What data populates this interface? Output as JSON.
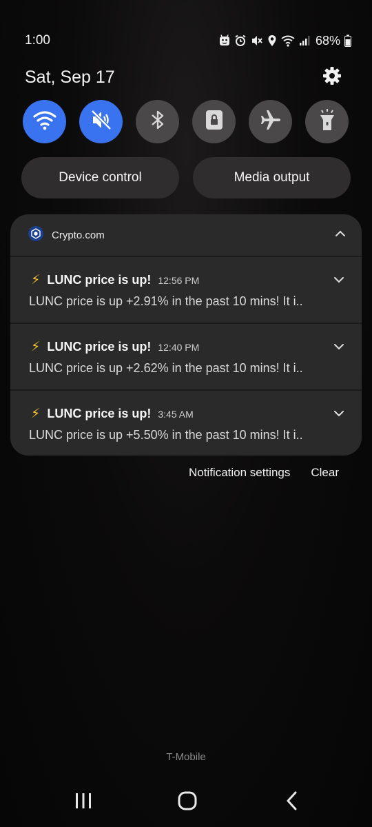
{
  "status_bar": {
    "time": "1:00",
    "battery_percent": "68%",
    "icons": [
      "android-icon",
      "alarm-icon",
      "mute-icon",
      "location-icon",
      "wifi-icon",
      "signal-icon",
      "battery-icon"
    ]
  },
  "quick_panel": {
    "date": "Sat, Sep 17",
    "toggles": [
      {
        "name": "wifi",
        "icon": "wifi-icon",
        "state": "on"
      },
      {
        "name": "sound",
        "icon": "mute-icon",
        "state": "on"
      },
      {
        "name": "bluetooth",
        "icon": "bluetooth-icon",
        "state": "off"
      },
      {
        "name": "portrait-lock",
        "icon": "lock-icon",
        "state": "off"
      },
      {
        "name": "airplane-mode",
        "icon": "airplane-icon",
        "state": "off"
      },
      {
        "name": "flashlight",
        "icon": "flashlight-icon",
        "state": "off"
      }
    ],
    "device_control_label": "Device control",
    "media_output_label": "Media output"
  },
  "notifications": {
    "app_name": "Crypto.com",
    "items": [
      {
        "emoji": "⚡",
        "title": "LUNC price is up!",
        "time": "12:56 PM",
        "body": "LUNC price is up +2.91% in the past 10 mins! It i.."
      },
      {
        "emoji": "⚡",
        "title": "LUNC price is up!",
        "time": "12:40 PM",
        "body": "LUNC price is up +2.62% in the past 10 mins! It i.."
      },
      {
        "emoji": "⚡",
        "title": "LUNC price is up!",
        "time": "3:45 AM",
        "body": "LUNC price is up +5.50% in the past 10 mins! It i.."
      }
    ],
    "settings_label": "Notification settings",
    "clear_label": "Clear"
  },
  "carrier": "T-Mobile",
  "colors": {
    "accent_blue": "#3a73f0",
    "toggle_off": "#4a4848",
    "panel_bg": "#2b2a2a",
    "bolt": "#f6c028"
  }
}
